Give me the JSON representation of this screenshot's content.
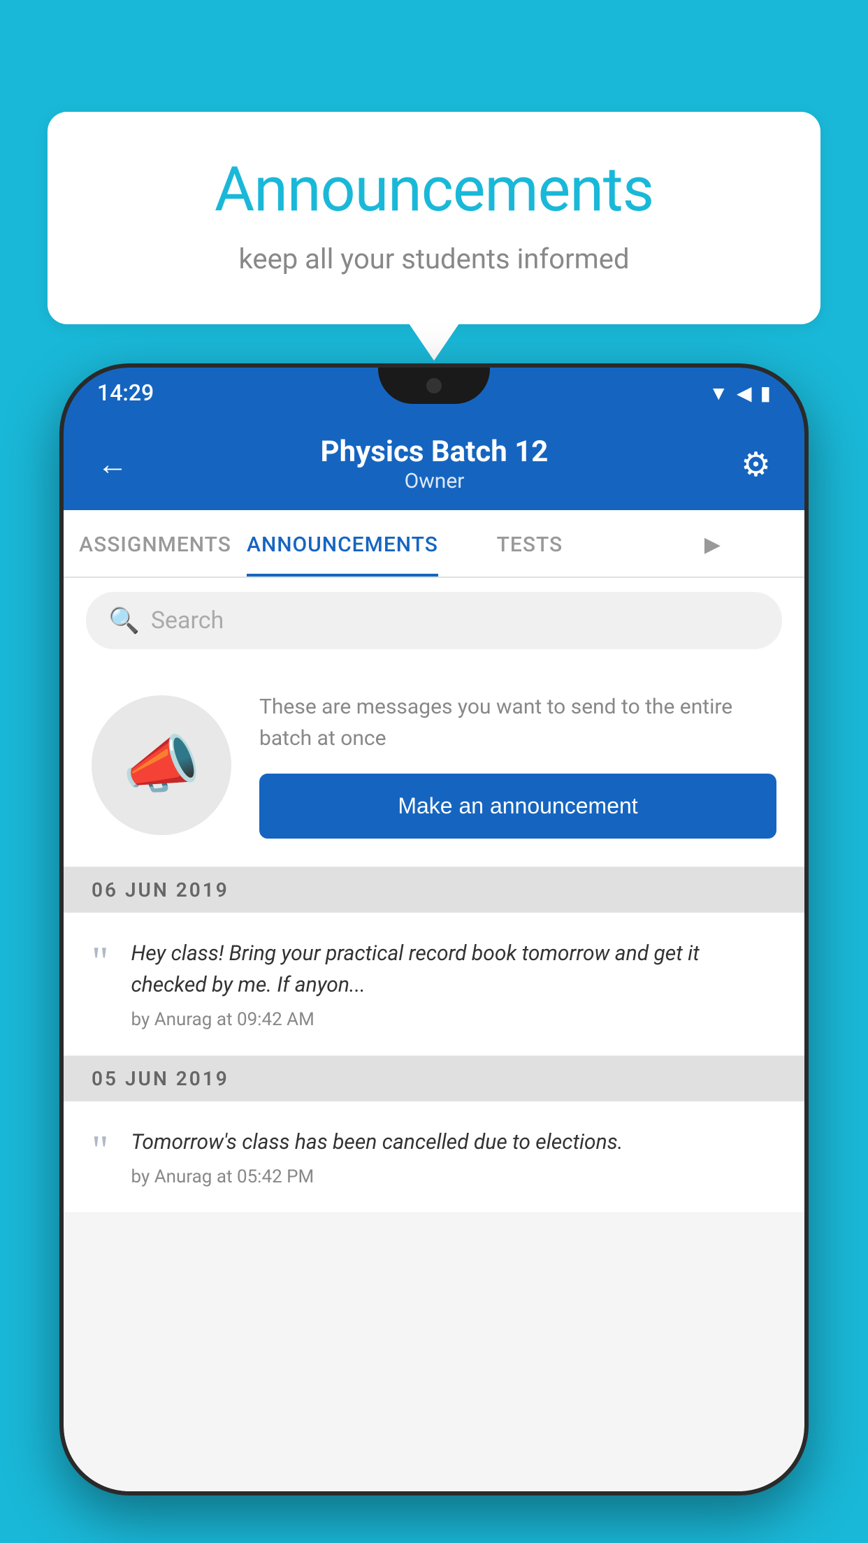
{
  "background_color": "#1ab8d8",
  "speech_bubble": {
    "title": "Announcements",
    "subtitle": "keep all your students informed"
  },
  "phone": {
    "status_bar": {
      "time": "14:29",
      "icons": [
        "wifi",
        "signal",
        "battery"
      ]
    },
    "header": {
      "title": "Physics Batch 12",
      "subtitle": "Owner",
      "back_label": "←",
      "gear_label": "⚙"
    },
    "tabs": [
      {
        "label": "ASSIGNMENTS",
        "active": false
      },
      {
        "label": "ANNOUNCEMENTS",
        "active": true
      },
      {
        "label": "TESTS",
        "active": false
      },
      {
        "label": "...",
        "active": false
      }
    ],
    "search": {
      "placeholder": "Search"
    },
    "promo": {
      "description": "These are messages you want to send to the entire batch at once",
      "button_label": "Make an announcement"
    },
    "announcements": [
      {
        "date": "06  JUN  2019",
        "text": "Hey class! Bring your practical record book tomorrow and get it checked by me. If anyon...",
        "meta": "by Anurag at 09:42 AM"
      },
      {
        "date": "05  JUN  2019",
        "text": "Tomorrow's class has been cancelled due to elections.",
        "meta": "by Anurag at 05:42 PM"
      }
    ]
  }
}
